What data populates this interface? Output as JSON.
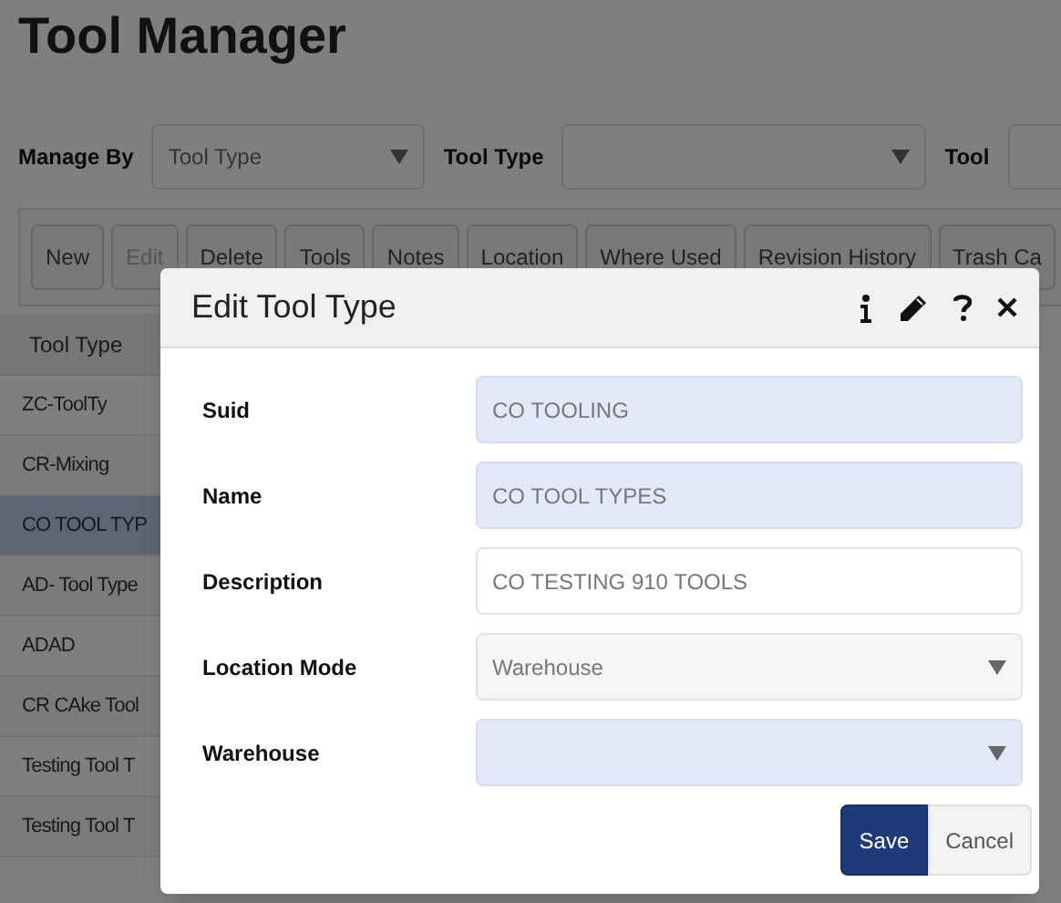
{
  "page": {
    "title": "Tool Manager"
  },
  "filters": [
    {
      "label": "Manage By",
      "value": "Tool Type"
    },
    {
      "label": "Tool Type"
    },
    {
      "label": "Tool"
    }
  ],
  "toolbar": [
    {
      "label": "New",
      "disabled": false
    },
    {
      "label": "Edit",
      "disabled": true
    },
    {
      "label": "Delete",
      "disabled": false
    },
    {
      "label": "Tools",
      "disabled": false
    },
    {
      "label": "Notes",
      "disabled": false
    },
    {
      "label": "Location",
      "disabled": false
    },
    {
      "label": "Where Used",
      "disabled": false
    },
    {
      "label": "Revision History",
      "disabled": false
    },
    {
      "label": "Trash Ca",
      "disabled": false
    }
  ],
  "table": {
    "columns": [
      "Tool Type"
    ],
    "rows": [
      {
        "cell": "ZC-ToolTy",
        "selected": false
      },
      {
        "cell": "CR-Mixing",
        "selected": false
      },
      {
        "cell": "CO TOOL TYP",
        "selected": true
      },
      {
        "cell": "AD- Tool Type",
        "selected": false
      },
      {
        "cell": "ADAD",
        "selected": false
      },
      {
        "cell": "CR CAke Tool",
        "selected": false
      },
      {
        "cell": "Testing Tool T",
        "selected": false
      },
      {
        "cell": "Testing Tool T",
        "selected": false
      }
    ]
  },
  "dialog": {
    "title": "Edit Tool Type",
    "fields": [
      {
        "label": "Suid",
        "kind": "text",
        "value": "CO TOOLING",
        "readonly": true
      },
      {
        "label": "Name",
        "kind": "text",
        "value": "CO TOOL TYPES",
        "readonly": true
      },
      {
        "label": "Description",
        "kind": "text",
        "value": "CO TESTING 910 TOOLS",
        "readonly": false
      },
      {
        "label": "Location Mode",
        "kind": "select",
        "value": "Warehouse",
        "readonly": false
      },
      {
        "label": "Warehouse",
        "kind": "select",
        "readonly": true
      }
    ],
    "buttons": [
      {
        "label": "Save",
        "primary": true
      },
      {
        "label": "Cancel",
        "primary": false
      }
    ]
  }
}
